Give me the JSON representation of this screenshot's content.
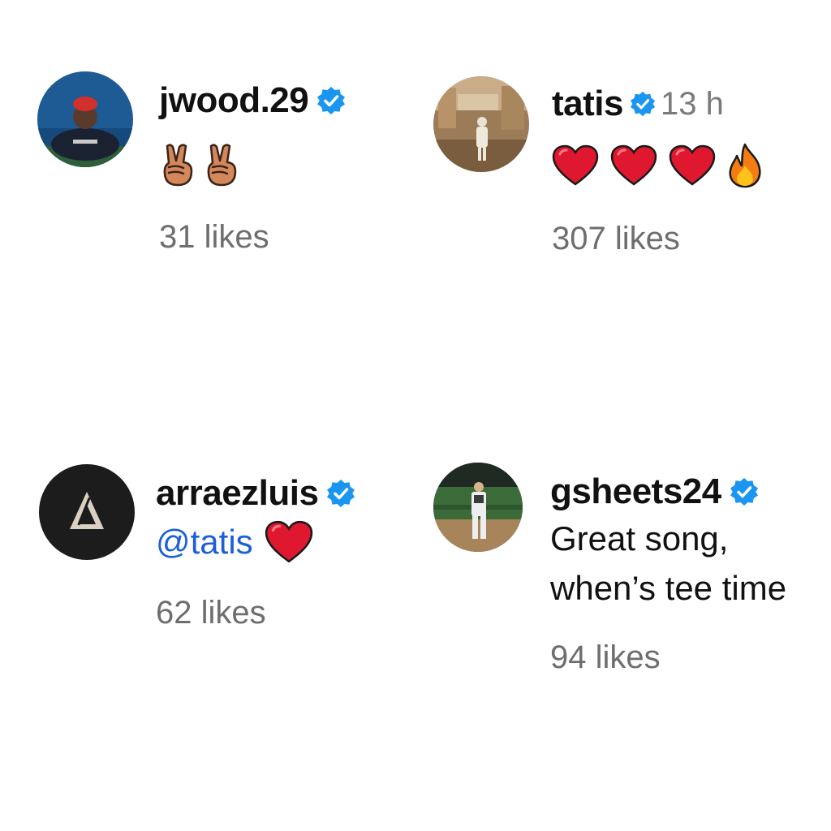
{
  "comments": [
    {
      "username": "jwood.29",
      "verified": true,
      "timestamp": "",
      "emojis": [
        "victory-hand",
        "victory-hand"
      ],
      "likes": "31 likes"
    },
    {
      "username": "tatis",
      "verified": true,
      "timestamp": "13 h",
      "emojis": [
        "red-heart",
        "red-heart",
        "red-heart",
        "fire"
      ],
      "likes": "307 likes"
    },
    {
      "username": "arraezluis",
      "verified": true,
      "timestamp": "",
      "mention": "@tatis",
      "emojis": [
        "red-heart"
      ],
      "likes": "62 likes"
    },
    {
      "username": "gsheets24",
      "verified": true,
      "timestamp": "",
      "text_line_1": "Great song,",
      "text_line_2": "when’s tee time",
      "likes": "94 likes"
    }
  ],
  "colors": {
    "verified_badge": "#1a96f0",
    "mention": "#1d5fd8",
    "likes_text": "#6e6e6e",
    "timestamp_text": "#7a7a7a",
    "heart": "#e0182f"
  }
}
